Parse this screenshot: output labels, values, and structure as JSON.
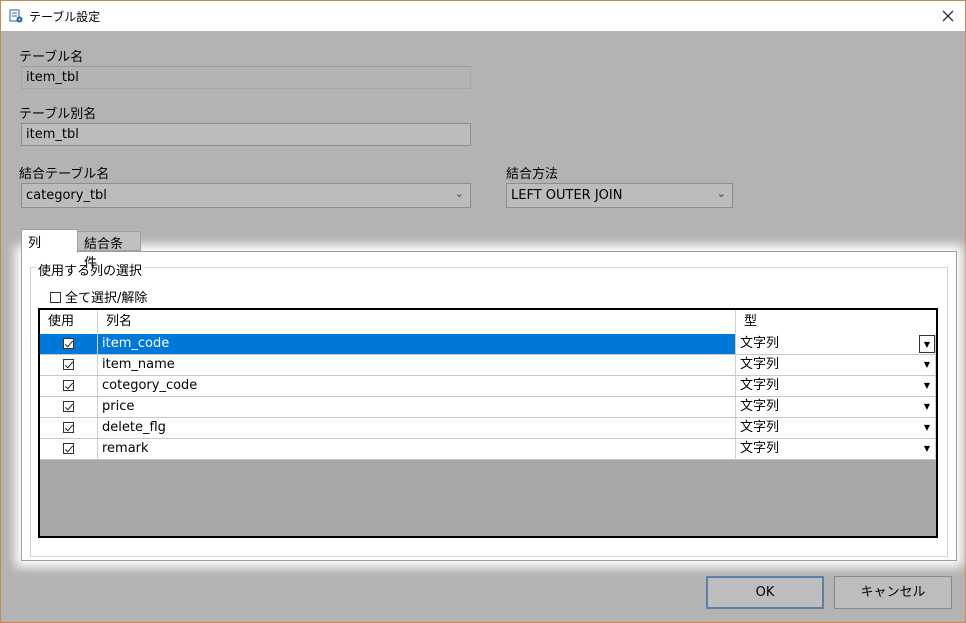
{
  "window": {
    "title": "テーブル設定"
  },
  "form": {
    "table_name_label": "テーブル名",
    "table_name_value": "item_tbl",
    "table_alias_label": "テーブル別名",
    "table_alias_value": "item_tbl",
    "join_table_label": "結合テーブル名",
    "join_table_value": "category_tbl",
    "join_method_label": "結合方法",
    "join_method_value": "LEFT OUTER JOIN"
  },
  "tabs": [
    {
      "label": "列",
      "active": true
    },
    {
      "label": "結合条件",
      "active": false
    }
  ],
  "columns_panel": {
    "group_title": "使用する列の選択",
    "select_all_label": "全て選択/解除",
    "select_all_checked": false,
    "headers": {
      "use": "使用",
      "name": "列名",
      "type": "型"
    },
    "rows": [
      {
        "checked": true,
        "name": "item_code",
        "type": "文字列",
        "selected": true
      },
      {
        "checked": true,
        "name": "item_name",
        "type": "文字列",
        "selected": false
      },
      {
        "checked": true,
        "name": "cotegory_code",
        "type": "文字列",
        "selected": false
      },
      {
        "checked": true,
        "name": "price",
        "type": "文字列",
        "selected": false
      },
      {
        "checked": true,
        "name": "delete_flg",
        "type": "文字列",
        "selected": false
      },
      {
        "checked": true,
        "name": "remark",
        "type": "文字列",
        "selected": false
      }
    ]
  },
  "buttons": {
    "ok": "OK",
    "cancel": "キャンセル"
  }
}
